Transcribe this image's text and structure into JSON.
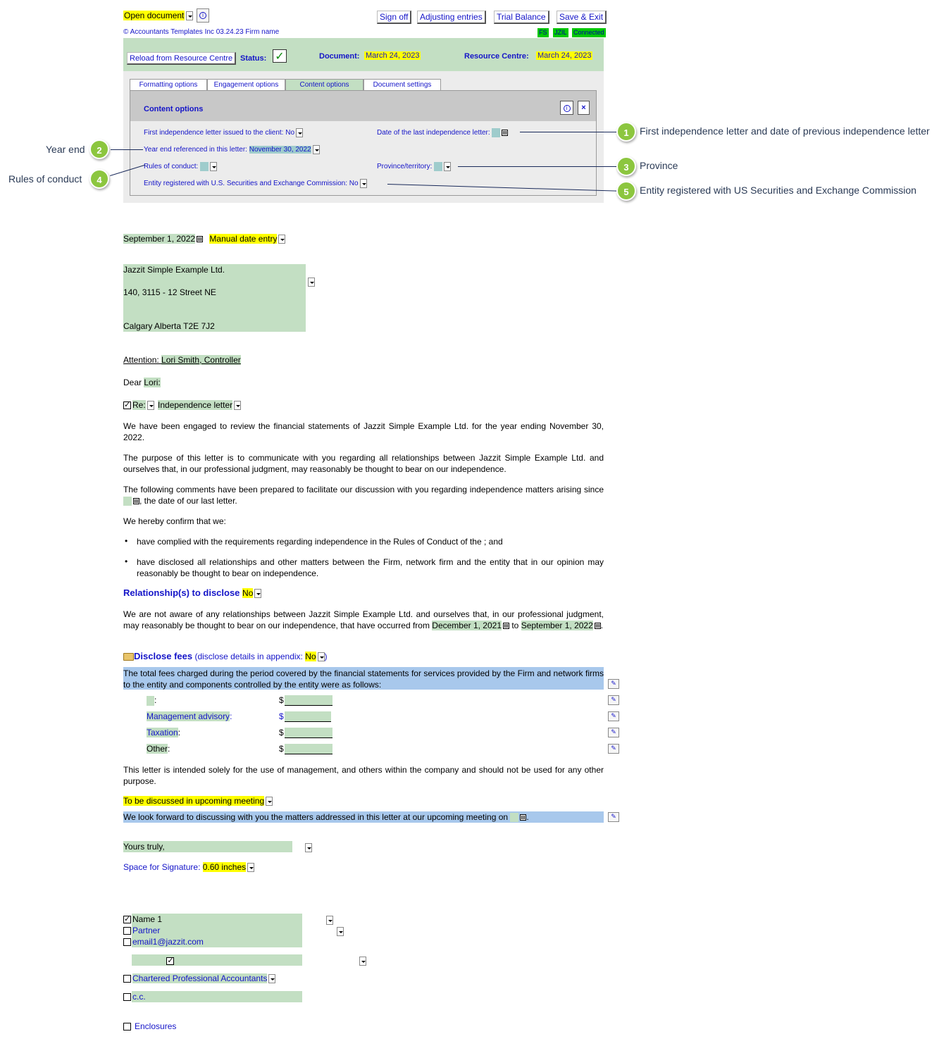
{
  "toolbar": {
    "open_document": "Open document",
    "sign_off": "Sign off",
    "adjusting_entries": "Adjusting entries",
    "trial_balance": "Trial Balance",
    "save_exit": "Save & Exit",
    "copyright": "© Accountants Templates Inc 03.24.23  Firm name",
    "tag_fs": "FS",
    "tag_jzil": "JZIL",
    "tag_connected": "Connected"
  },
  "status_bar": {
    "reload": "Reload from Resource Centre",
    "status_label": "Status:",
    "document_label": "Document:",
    "document_date": "March 24, 2023",
    "resource_label": "Resource Centre:",
    "resource_date": "March 24, 2023"
  },
  "tabs": [
    {
      "label": "Formatting options"
    },
    {
      "label": "Engagement options"
    },
    {
      "label": "Content options"
    },
    {
      "label": "Document settings"
    }
  ],
  "content_options": {
    "title": "Content options",
    "first_letter_label": "First independence letter issued to the client:",
    "first_letter_value": "No",
    "last_letter_label": "Date of the last independence letter:",
    "year_end_label": "Year end referenced in this letter:",
    "year_end_value": "November 30, 2022",
    "rules_label": "Rules of conduct:",
    "province_label": "Province/territory:",
    "sec_label": "Entity registered with U.S. Securities and Exchange Commission:",
    "sec_value": "No"
  },
  "callouts": [
    {
      "num": "1",
      "text": "First independence letter and date of previous independence letter"
    },
    {
      "num": "2",
      "text": "Year end"
    },
    {
      "num": "3",
      "text": "Province"
    },
    {
      "num": "4",
      "text": "Rules of conduct"
    },
    {
      "num": "5",
      "text": "Entity registered with US Securities and Exchange Commission"
    }
  ],
  "letter": {
    "date": "September 1, 2022",
    "date_mode": "Manual date entry",
    "address_line1": "Jazzit Simple Example Ltd.",
    "address_line2": "140, 3115 - 12 Street NE",
    "address_line3": "Calgary Alberta  T2E 7J2",
    "attention_label": "Attention: ",
    "attention_value": "Lori Smith, Controller",
    "dear_label": "Dear ",
    "dear_value": "Lori:",
    "re_label": "Re:",
    "re_value": "Independence letter",
    "p1": "We have been engaged to review the financial statements of Jazzit Simple Example Ltd.   for the year ending November 30, 2022.",
    "p2": "The purpose of this letter is to communicate with you regarding all relationships between Jazzit Simple Example Ltd. and ourselves that, in our professional judgment, may reasonably be thought to bear on our independence.",
    "p3a": "The following comments have been prepared to facilitate our discussion with you regarding independence matters arising since ",
    "p3b": ", the date of our last letter.",
    "p4": "We hereby confirm that we:",
    "bullet1": "have complied with the requirements regarding independence in the Rules of Conduct of the    ; and",
    "bullet2": "have disclosed all relationships and other matters between the Firm, network firm and the entity that in our opinion may reasonably be thought to bear on independence.",
    "relationships_label": "Relationship(s) to disclose",
    "relationships_value": "No",
    "p5a": "We are not aware of any relationships between Jazzit Simple Example Ltd. and ourselves that, in our professional judgment, may reasonably be thought to bear on our independence, that have occurred from ",
    "p5_from": "December 1, 2021",
    "p5b": " to",
    "p5_to": "September 1, 2022",
    "disclose_label": "Disclose fees",
    "disclose_paren": " (disclose details in appendix: ",
    "disclose_value": "No",
    "disclose_close": ")",
    "fees_intro": "The total fees charged during the period covered by the financial statements for   services provided by the Firm and network firms to the entity and components controlled by the entity were as follows:",
    "fee_rows": [
      {
        "label": ":",
        "currency": "$"
      },
      {
        "label": "Management advisory",
        "suffix": ":",
        "currency": "$"
      },
      {
        "label": "Taxation",
        "suffix": ":",
        "currency": "$"
      },
      {
        "label": "Other",
        "suffix": ":",
        "currency": "$"
      }
    ],
    "p6": "This letter is intended solely for the use of  management, and others within the company and should not be used for any other purpose.",
    "meeting_mode": "To be discussed in upcoming meeting",
    "meeting_text": "We look forward to discussing with you the matters addressed in this letter at our upcoming meeting on",
    "closing": "Yours truly,",
    "signature_label": "Space for Signature: ",
    "signature_value": "0.60 inches",
    "signer_name": "Name 1",
    "signer_title": "Partner",
    "signer_email": "email1@jazzit.com",
    "cpa": "Chartered Professional Accountants",
    "cc": "c.c.",
    "enclosures": "Enclosures"
  }
}
